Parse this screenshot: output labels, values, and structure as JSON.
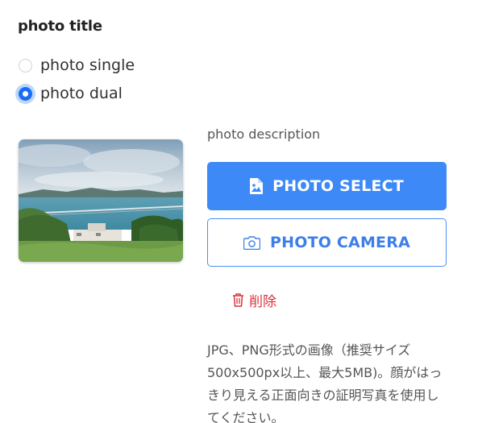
{
  "form": {
    "title": "photo title",
    "options": [
      {
        "label": "photo single",
        "selected": false
      },
      {
        "label": "photo dual",
        "selected": true
      }
    ],
    "accent_color": "#1a6ef5"
  },
  "upload": {
    "description": "photo description",
    "select_label": "PHOTO SELECT",
    "select_icon": "image-file-icon",
    "camera_label": "PHOTO CAMERA",
    "camera_icon": "camera-icon",
    "delete_label": "削除",
    "delete_icon": "trash-icon",
    "primary_color": "#3d89f7",
    "danger_color": "#d9343e",
    "note": "JPG、PNG形式の画像（推奨サイズ500x500px以上、最大5MB)。顔がはっきり見える正面向きの証明写真を使用してください。"
  }
}
